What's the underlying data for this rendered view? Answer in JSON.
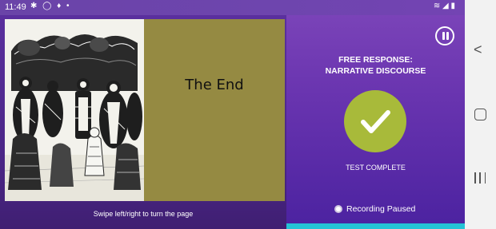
{
  "status_bar": {
    "time": "11:49",
    "left_icons": "✱ ◯ ♦ •",
    "right_icons": "≋ ◢ ▮"
  },
  "book": {
    "page_text": "The End",
    "swipe_hint": "Swipe left/right to turn the page",
    "illustration": "queen-of-hearts-court-engraving"
  },
  "panel": {
    "title_line1": "FREE RESPONSE:",
    "title_line2": "NARRATIVE DISCOURSE",
    "status": "TEST COMPLETE",
    "recording": "Recording Paused"
  },
  "colors": {
    "purple": "#6a35b0",
    "olive": "#958a42",
    "check_green": "#a8ba3a",
    "cyan": "#24c3d5"
  },
  "nav": {
    "back_icon": "chevron-left-icon",
    "home_icon": "home-square-icon",
    "recents_icon": "recents-icon"
  }
}
